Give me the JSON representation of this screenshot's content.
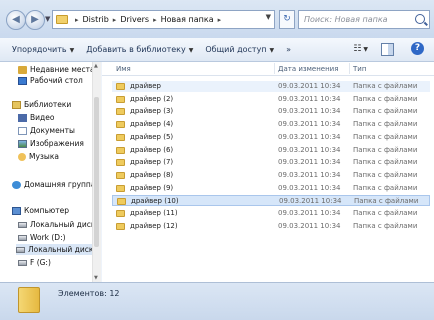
{
  "address": {
    "breadcrumbs": [
      "Distrib",
      "Drivers",
      "Новая папка"
    ],
    "search_placeholder": "Поиск: Новая папка"
  },
  "toolbar": {
    "organize": "Упорядочить",
    "add_to_library": "Добавить в библиотеку",
    "share": "Общий доступ",
    "more": "»"
  },
  "nav": {
    "items": [
      {
        "label": "Недавние места"
      },
      {
        "label": "Рабочий стол"
      },
      {
        "label": "Библиотеки"
      },
      {
        "label": "Видео"
      },
      {
        "label": "Документы"
      },
      {
        "label": "Изображения"
      },
      {
        "label": "Музыка"
      },
      {
        "label": "Домашняя группа"
      },
      {
        "label": "Компьютер"
      },
      {
        "label": "Локальный диск"
      },
      {
        "label": "Work (D:)"
      },
      {
        "label": "Локальный диск"
      },
      {
        "label": "F (G:)"
      }
    ]
  },
  "list": {
    "headers": {
      "name": "Имя",
      "date": "Дата изменения",
      "type": "Тип"
    },
    "rows": [
      {
        "name": "драйвер",
        "date": "09.03.2011 10:34",
        "type": "Папка с файлами"
      },
      {
        "name": "драйвер (2)",
        "date": "09.03.2011 10:34",
        "type": "Папка с файлами"
      },
      {
        "name": "драйвер (3)",
        "date": "09.03.2011 10:34",
        "type": "Папка с файлами"
      },
      {
        "name": "драйвер (4)",
        "date": "09.03.2011 10:34",
        "type": "Папка с файлами"
      },
      {
        "name": "драйвер (5)",
        "date": "09.03.2011 10:34",
        "type": "Папка с файлами"
      },
      {
        "name": "драйвер (6)",
        "date": "09.03.2011 10:34",
        "type": "Папка с файлами"
      },
      {
        "name": "драйвер (7)",
        "date": "09.03.2011 10:34",
        "type": "Папка с файлами"
      },
      {
        "name": "драйвер (8)",
        "date": "09.03.2011 10:34",
        "type": "Папка с файлами"
      },
      {
        "name": "драйвер (9)",
        "date": "09.03.2011 10:34",
        "type": "Папка с файлами"
      },
      {
        "name": "драйвер (10)",
        "date": "09.03.2011 10:34",
        "type": "Папка с файлами"
      },
      {
        "name": "драйвер (11)",
        "date": "09.03.2011 10:34",
        "type": "Папка с файлами"
      },
      {
        "name": "драйвер (12)",
        "date": "09.03.2011 10:34",
        "type": "Папка с файлами"
      }
    ]
  },
  "status": {
    "text": "Элементов: 12"
  }
}
